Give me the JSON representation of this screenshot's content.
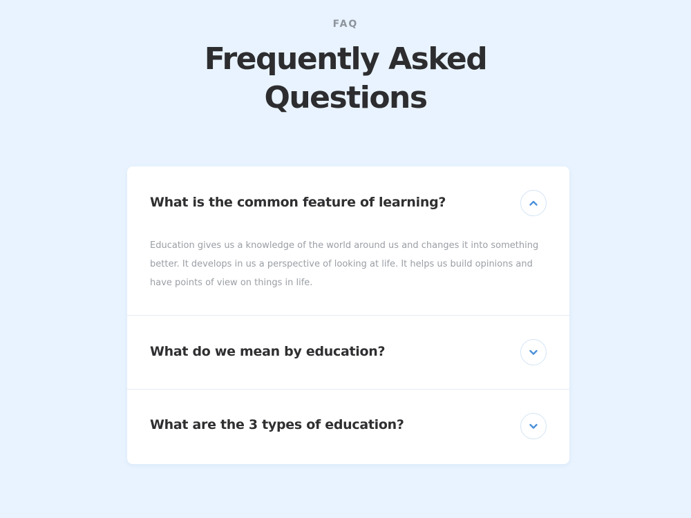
{
  "header": {
    "eyebrow": "FAQ",
    "title": "Frequently Asked Questions"
  },
  "colors": {
    "background": "#e8f3ff",
    "card": "#ffffff",
    "accent": "#4a90d9",
    "heading": "#2d2d2f",
    "muted": "#9a9ea4"
  },
  "faq": {
    "items": [
      {
        "question": "What is the common feature of learning?",
        "answer": "Education gives us a knowledge of the world around us and changes it into something better. It develops in us a perspective of looking at life. It helps us build opinions and have points of view on things in life.",
        "expanded": true,
        "icon": "chevron-up-icon"
      },
      {
        "question": "What do we mean by education?",
        "expanded": false,
        "icon": "chevron-down-icon"
      },
      {
        "question": "What are the 3 types of education?",
        "expanded": false,
        "icon": "chevron-down-icon"
      }
    ]
  }
}
